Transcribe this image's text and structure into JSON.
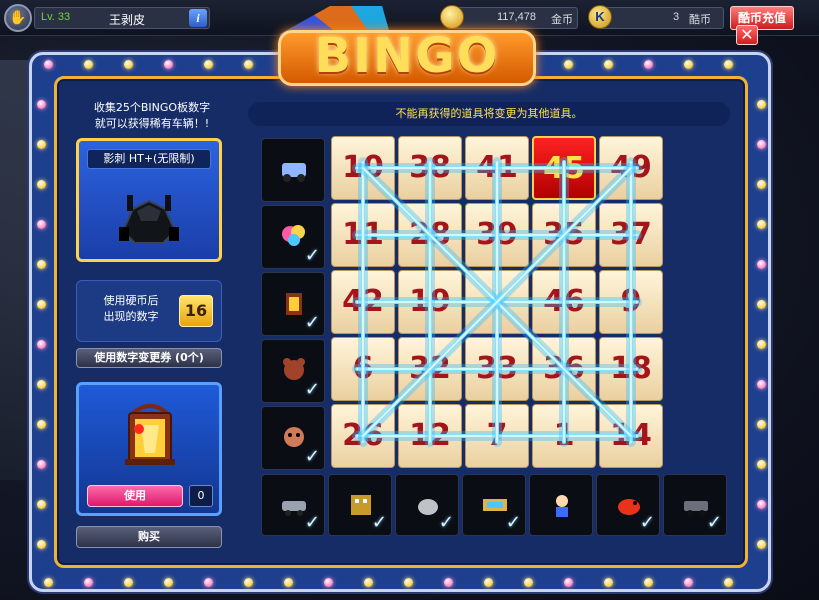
{
  "hud": {
    "avatar_icon": "trophy-icon",
    "level": "Lv. 33",
    "player_name": "王剥皮",
    "info_label": "i",
    "gold_value": "117,478",
    "gold_unit": "金币",
    "k_label": "K",
    "k_value": "3",
    "k_unit": "酷币",
    "recharge_label": "酷币充值"
  },
  "logo": {
    "text": "BINGO"
  },
  "close_label": "✕",
  "left_panel": {
    "intro_line1": "收集25个BINGO板数字",
    "intro_line2": "就可以获得稀有车辆！!",
    "reward_name": "影刺  HT+(无限制)",
    "coin_label_line1": "使用硬币后",
    "coin_label_line2": "出现的数字",
    "coin_number": "16",
    "coupon_button": "使用数字变更券 (0个)",
    "use_button": "使用",
    "use_count": "0",
    "buy_button": "购买"
  },
  "notice": "不能再获得的道具将变更为其他道具。",
  "board": {
    "rows": [
      [
        "10",
        "38",
        "41",
        "45",
        "49"
      ],
      [
        "11",
        "28",
        "39",
        "35",
        "37"
      ],
      [
        "42",
        "19",
        "",
        "46",
        "9"
      ],
      [
        "6",
        "32",
        "33",
        "36",
        "18"
      ],
      [
        "26",
        "12",
        "7",
        "1",
        "14"
      ]
    ],
    "highlight": {
      "row": 0,
      "col": 3
    },
    "row_prizes": [
      {
        "icon": "kart-icon",
        "checked": false
      },
      {
        "icon": "balloon-icon",
        "checked": true
      },
      {
        "icon": "lantern-icon",
        "checked": true
      },
      {
        "icon": "bear-icon",
        "checked": true
      },
      {
        "icon": "teddy-icon",
        "checked": true
      }
    ],
    "col_prizes": [
      {
        "icon": "car-icon",
        "checked": true
      },
      {
        "icon": "robot-icon",
        "checked": true
      },
      {
        "icon": "rock-icon",
        "checked": true
      },
      {
        "icon": "ticket-icon",
        "checked": true
      },
      {
        "icon": "character-icon",
        "checked": false
      },
      {
        "icon": "bird-icon",
        "checked": true
      },
      {
        "icon": "vehicle-icon",
        "checked": true
      }
    ],
    "check_glyph": "✓",
    "lines_count": 12
  },
  "colors": {
    "frame_blue": "#1e3f8e",
    "gold": "#ffd24a",
    "number_red": "#a3141c",
    "laser": "#7fe6ff"
  }
}
